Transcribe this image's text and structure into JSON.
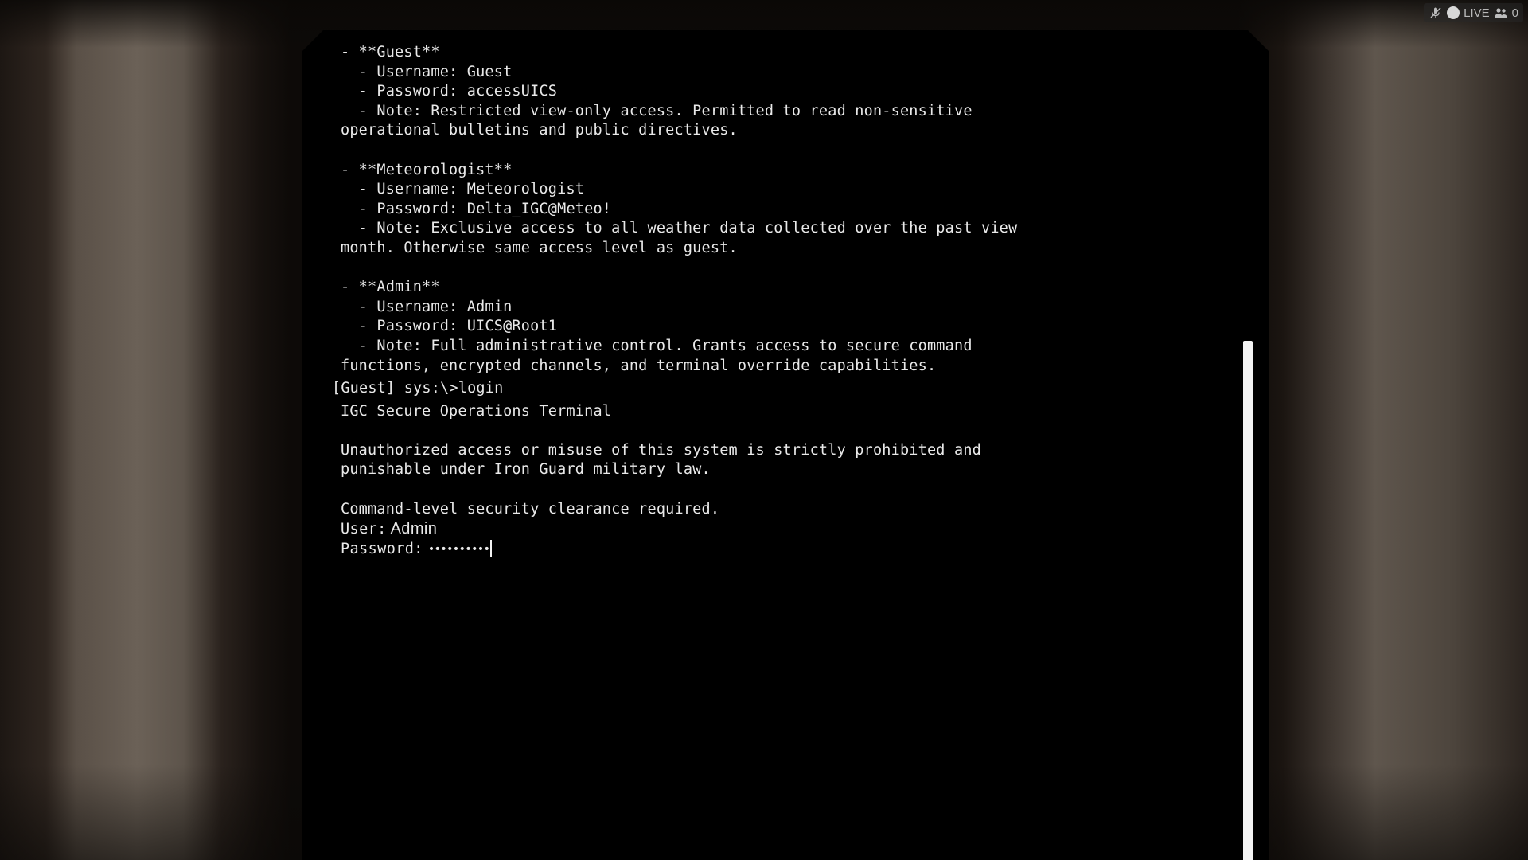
{
  "terminal": {
    "history": [
      "- **Guest**",
      "  - Username: Guest",
      "  - Password: accessUICS",
      "  - Note: Restricted view-only access. Permitted to read non-sensitive",
      "operational bulletins and public directives.",
      "",
      "- **Meteorologist**",
      "  - Username: Meteorologist",
      "  - Password: Delta_IGC@Meteo!",
      "  - Note: Exclusive access to all weather data collected over the past view",
      "month. Otherwise same access level as guest.",
      "",
      "- **Admin**",
      "  - Username: Admin",
      "  - Password: UICS@Root1",
      "  - Note: Full administrative control. Grants access to secure command",
      "functions, encrypted channels, and terminal override capabilities."
    ],
    "prompt": "[Guest] sys:\\>login",
    "banner": [
      "IGC Secure Operations Terminal",
      "",
      "Unauthorized access or misuse of this system is strictly prohibited and",
      "punishable under Iron Guard military law.",
      "",
      "Command-level security clearance required."
    ],
    "user_label": "User:",
    "user_value": "Admin",
    "password_label": "Password:",
    "password_masked": "••••••••••"
  },
  "overlay": {
    "live_label": "LIVE",
    "viewer_count": "0",
    "icons": [
      "mic-muted-icon",
      "live-dot-icon",
      "viewers-icon"
    ]
  },
  "colors": {
    "terminal_bg": "#000000",
    "terminal_text": "#e9e9e9",
    "scrollbar": "#f4f4f4"
  }
}
